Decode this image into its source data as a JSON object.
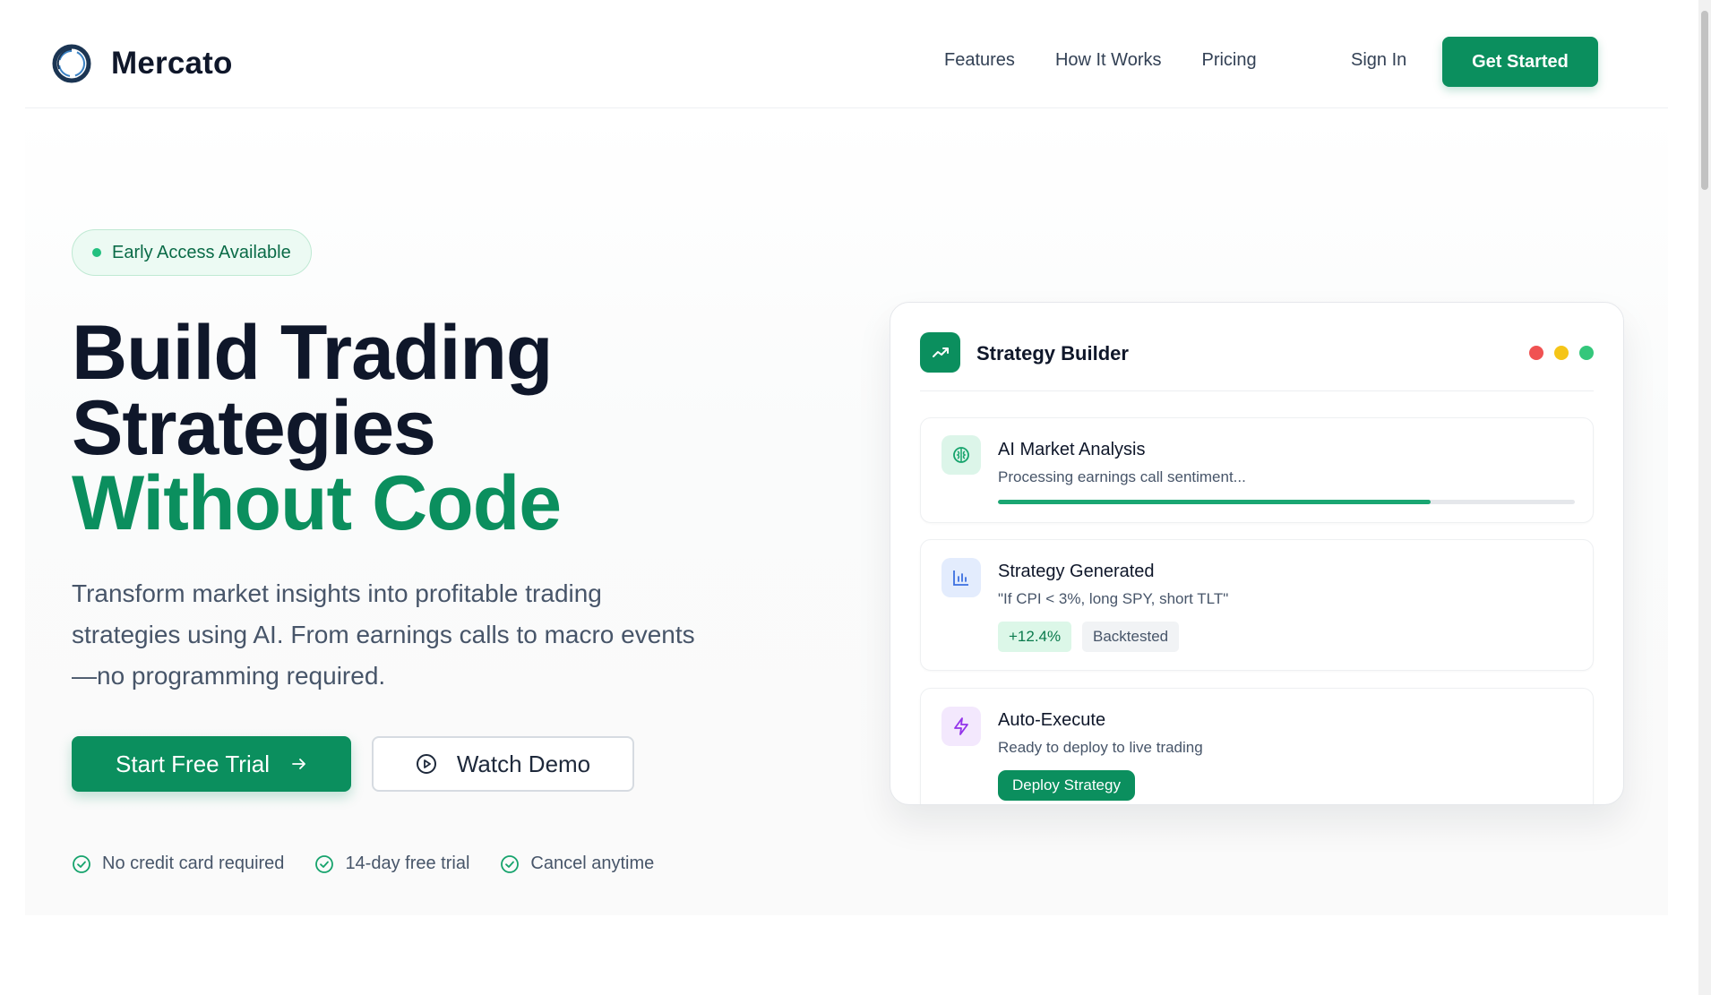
{
  "brand": {
    "name": "Mercato"
  },
  "nav": {
    "links": [
      "Features",
      "How It Works",
      "Pricing"
    ],
    "sign_in": "Sign In",
    "get_started": "Get Started"
  },
  "hero": {
    "badge": "Early Access Available",
    "title_line1": "Build Trading",
    "title_line2": "Strategies",
    "title_line3": "Without Code",
    "subtitle": "Transform market insights into profitable trading strategies using AI. From earnings calls to macro events—no programming required.",
    "primary_cta": "Start Free Trial",
    "secondary_cta": "Watch Demo",
    "checks": [
      "No credit card required",
      "14-day free trial",
      "Cancel anytime"
    ]
  },
  "card": {
    "title": "Strategy Builder",
    "window_dots": [
      "#f05252",
      "#f5c518",
      "#34c77b"
    ],
    "items": [
      {
        "title": "AI Market Analysis",
        "desc": "Processing earnings call sentiment...",
        "progress": 0.75,
        "icon": "brain-icon"
      },
      {
        "title": "Strategy Generated",
        "desc": "\"If CPI < 3%, long SPY, short TLT\"",
        "tags": [
          "+12.4%",
          "Backtested"
        ],
        "icon": "bar-chart-icon"
      },
      {
        "title": "Auto-Execute",
        "desc": "Ready to deploy to live trading",
        "action": "Deploy Strategy",
        "icon": "lightning-icon"
      }
    ]
  },
  "colors": {
    "accent": "#0b8f5e",
    "text": "#0f172a",
    "muted": "#475569"
  }
}
